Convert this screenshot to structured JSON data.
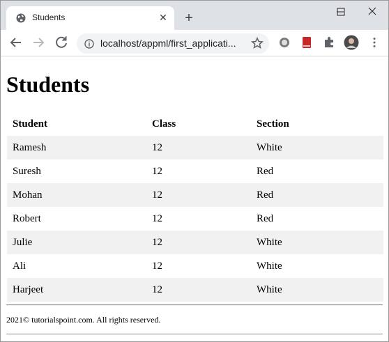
{
  "browser": {
    "tab_title": "Students",
    "new_tab_symbol": "+",
    "close_symbol": "✕",
    "address": "localhost/appml/first_applicati...",
    "icons": [
      "globe-icon",
      "close-icon",
      "plus-icon",
      "minimize-icon",
      "maximize-icon",
      "window-close-icon",
      "back-icon",
      "forward-icon",
      "reload-icon",
      "info-icon",
      "star-icon",
      "extension-dot-icon",
      "book-icon",
      "puzzle-icon",
      "avatar",
      "more-icon"
    ]
  },
  "page": {
    "heading": "Students",
    "table": {
      "headers": [
        "Student",
        "Class",
        "Section"
      ],
      "rows": [
        [
          "Ramesh",
          "12",
          "White"
        ],
        [
          "Suresh",
          "12",
          "Red"
        ],
        [
          "Mohan",
          "12",
          "Red"
        ],
        [
          "Robert",
          "12",
          "Red"
        ],
        [
          "Julie",
          "12",
          "White"
        ],
        [
          "Ali",
          "12",
          "White"
        ],
        [
          "Harjeet",
          "12",
          "White"
        ]
      ]
    },
    "footer": "2021© tutorialspoint.com. All rights reserved."
  }
}
